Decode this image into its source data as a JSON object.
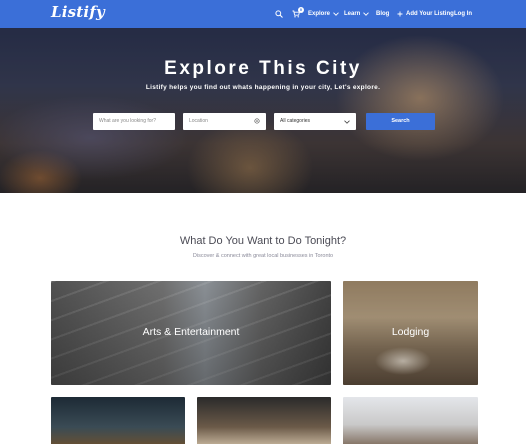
{
  "header": {
    "logo": "Listify",
    "cart_count": "0",
    "nav": [
      "Explore",
      "Learn",
      "Blog"
    ],
    "add_listing": "Add Your Listing",
    "login": "Log In",
    "brand_color": "#3b6fd8",
    "icons": [
      "search-icon",
      "cart-icon",
      "chevron-down-icon",
      "plus-icon"
    ]
  },
  "hero": {
    "title": "Explore This City",
    "subtitle": "Listify helps you find out whats happening in your city, Let's explore.",
    "keyword_placeholder": "What are you looking for?",
    "location_placeholder": "Location",
    "category_value": "All categories",
    "search_label": "Search"
  },
  "section": {
    "title": "What Do You Want to Do Tonight?",
    "subtitle": "Discover & connect with great local businesses in Toronto"
  },
  "cards": [
    {
      "label": "Arts & Entertainment"
    },
    {
      "label": "Lodging"
    },
    {
      "label": ""
    },
    {
      "label": ""
    },
    {
      "label": ""
    }
  ]
}
